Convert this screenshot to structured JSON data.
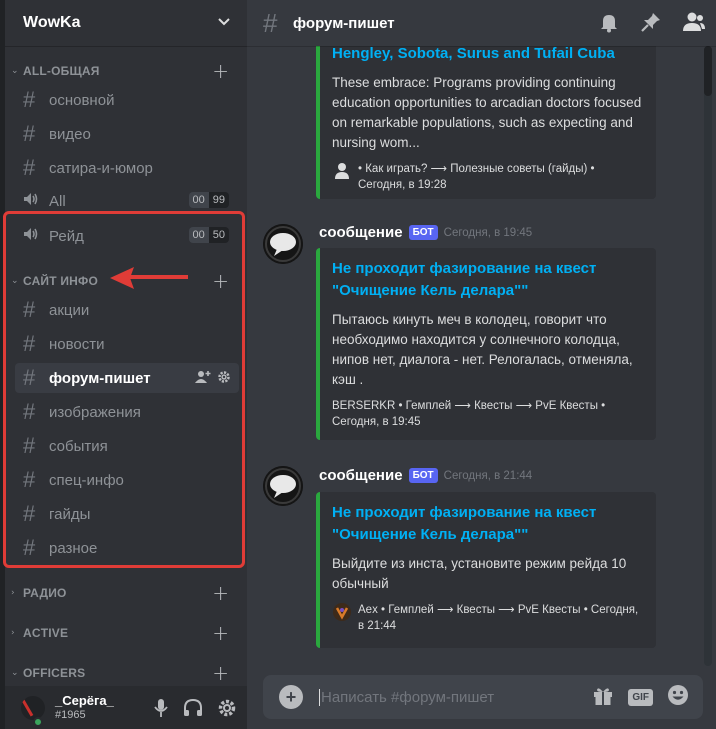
{
  "server": {
    "name": "WowKa"
  },
  "categories": {
    "all": "ALL-ОБЩАЯ",
    "site": "САЙТ ИНФО",
    "radio": "РАДИО",
    "active": "ACTIVE",
    "officers": "OFFICERS"
  },
  "channels": {
    "all_group": [
      {
        "name": "основной"
      },
      {
        "name": "видео"
      },
      {
        "name": "сатира-и-юмор"
      }
    ],
    "voice": [
      {
        "name": "All",
        "count": "00",
        "limit": "99"
      },
      {
        "name": "Рейд",
        "count": "00",
        "limit": "50"
      }
    ],
    "site_group": [
      {
        "name": "акции"
      },
      {
        "name": "новости"
      },
      {
        "name": "форум-пишет"
      },
      {
        "name": "изображения"
      },
      {
        "name": "события"
      },
      {
        "name": "спец-инфо"
      },
      {
        "name": "гайды"
      },
      {
        "name": "разное"
      }
    ]
  },
  "glyphs": {
    "hash": "#",
    "plus": "+",
    "chevron": "⌄",
    "arrow_open": "⌄",
    "arrow_closed": "›"
  },
  "user": {
    "name": "_Серёга_",
    "tag": "#1965"
  },
  "header": {
    "channel": "форум-пишет"
  },
  "messages": [
    {
      "embed_title": "Hengley, Sobota, Surus and Tufail Cuba",
      "embed_desc": "These embrace: Programs providing continuing education opportunities to arcadian doctors focused on remarkable populations, such as expecting and nursing wom...",
      "footer": "• Как играть? ⟶ Полезные советы (гайды) • Сегодня, в 19:28"
    },
    {
      "author": "сообщение",
      "bot": "БОТ",
      "time": "Сегодня, в 19:45",
      "embed_title": "Не проходит фазирование на квест \"Очищение Кель делара\"\"",
      "embed_desc": "Пытаюсь кинуть меч в колодец, говорит что необходимо находится у солнечного колодца, нипов нет, диалога - нет. Релогалась, отменяла, кэш .",
      "footer": "BERSERKR • Гемплей ⟶ Квесты ⟶ PvE Квесты • Сегодня, в 19:45"
    },
    {
      "author": "сообщение",
      "bot": "БОТ",
      "time": "Сегодня, в 21:44",
      "embed_title": "Не проходит фазирование на квест \"Очищение Кель делара\"\"",
      "embed_desc": "Выйдите из инста, установите режим рейда 10 обычный",
      "footer": "Aex • Гемплей ⟶ Квесты ⟶ PvE Квесты • Сегодня, в 21:44"
    }
  ],
  "composer": {
    "placeholder": "Написать #форум-пишет",
    "gif": "GIF"
  },
  "colors": {
    "accent_link": "#00b0f4",
    "embed_bar": "#2aa83e",
    "highlight": "#e03c37",
    "bot_tag": "#5865f2"
  }
}
